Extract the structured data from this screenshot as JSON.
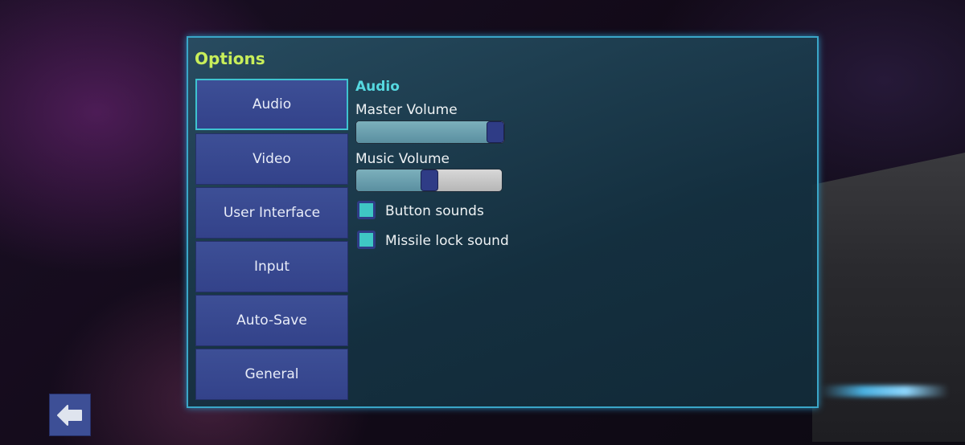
{
  "title": "Options",
  "tabs": [
    {
      "label": "Audio",
      "active": true
    },
    {
      "label": "Video"
    },
    {
      "label": "User Interface"
    },
    {
      "label": "Input"
    },
    {
      "label": "Auto-Save"
    },
    {
      "label": "General"
    }
  ],
  "audio": {
    "section_title": "Audio",
    "master_volume": {
      "label": "Master Volume",
      "value": 1.0
    },
    "music_volume": {
      "label": "Music Volume",
      "value": 0.5
    },
    "button_sounds": {
      "label": "Button sounds",
      "checked": true
    },
    "missile_lock_sound": {
      "label": "Missile lock sound",
      "checked": true
    }
  },
  "back_icon": "arrow-left-icon"
}
